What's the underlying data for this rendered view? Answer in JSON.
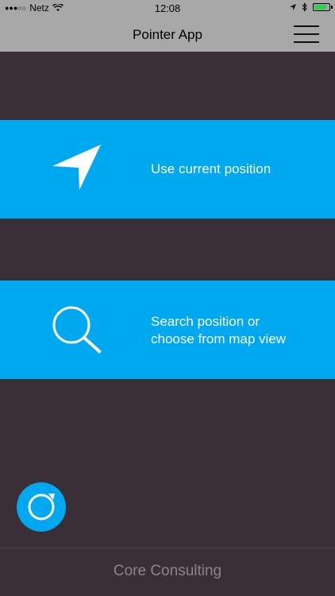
{
  "status_bar": {
    "carrier": "Netz",
    "time": "12:08",
    "signal_icon": "signal-dots-icon",
    "wifi_icon": "wifi-icon",
    "location_icon": "location-arrow-icon",
    "bluetooth_icon": "bluetooth-icon",
    "battery_icon": "battery-icon",
    "battery_level": 0.85
  },
  "nav": {
    "title": "Pointer App",
    "menu_icon": "hamburger-menu-icon"
  },
  "options": [
    {
      "label": "Use current position",
      "icon": "navigation-arrow-icon"
    },
    {
      "label": "Search position or\nchoose from map view",
      "icon": "magnifier-icon"
    }
  ],
  "fab": {
    "icon": "compass-icon"
  },
  "footer": {
    "text": "Core Consulting"
  },
  "colors": {
    "accent": "#00a8f0",
    "background": "#3a2f36",
    "bar": "#a8a8a8",
    "footer_text": "#8b8489"
  }
}
